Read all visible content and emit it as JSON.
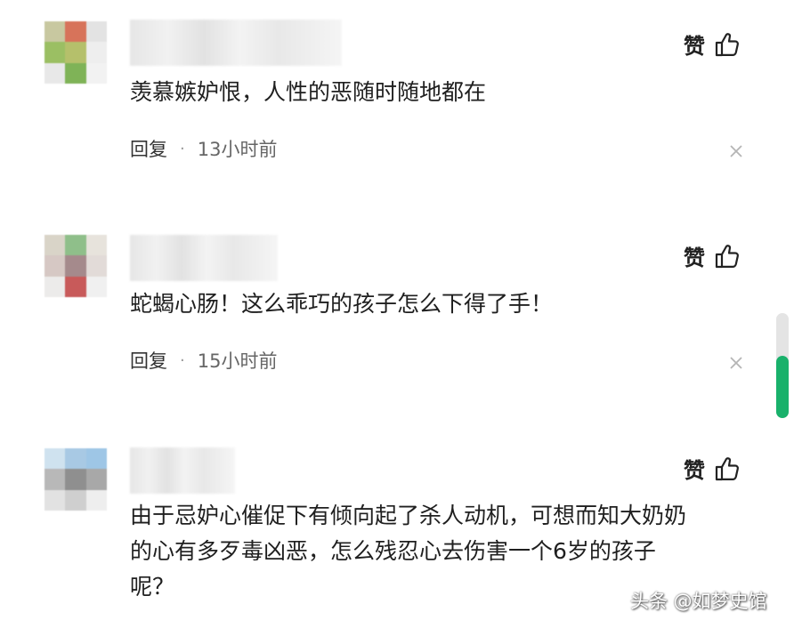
{
  "comments": [
    {
      "like_label": "赞",
      "text": "羡慕嫉妒恨，人性的恶随时随地都在",
      "reply_label": "回复",
      "separator": "·",
      "time": "13小时前",
      "avatar_colors": [
        "#c8c8a0",
        "#d7735a",
        "#e3e3e3",
        "#9bbf63",
        "#b5c06b",
        "#eeeeee",
        "#e8e8e8",
        "#7fb357",
        "#f2f2f2"
      ]
    },
    {
      "like_label": "赞",
      "text": "蛇蝎心肠！这么乖巧的孩子怎么下得了手！",
      "reply_label": "回复",
      "separator": "·",
      "time": "15小时前",
      "avatar_colors": [
        "#d9d4c8",
        "#8fbf8a",
        "#e7e3dc",
        "#d6c8c4",
        "#a58a8c",
        "#e2dbd8",
        "#ecebea",
        "#c85a5a",
        "#f0f0f0"
      ]
    },
    {
      "like_label": "赞",
      "text_lines": [
        "由于忌妒心催促下有倾向起了杀人动机，可想而知大奶奶",
        "的心有多歹毒凶恶，怎么残忍心去伤害一个6岁的孩子",
        "呢？"
      ],
      "avatar_colors": [
        "#cfe2ef",
        "#a8c9e4",
        "#9ec6e6",
        "#b8b8b8",
        "#8f8f8f",
        "#a8a8a8",
        "#e2e2e2",
        "#cfcfcf",
        "#eeeeee"
      ]
    }
  ],
  "watermark": "头条 @如梦史馆",
  "colors": {
    "scroll_thumb": "#19b16b",
    "text": "#1f1f1f"
  }
}
